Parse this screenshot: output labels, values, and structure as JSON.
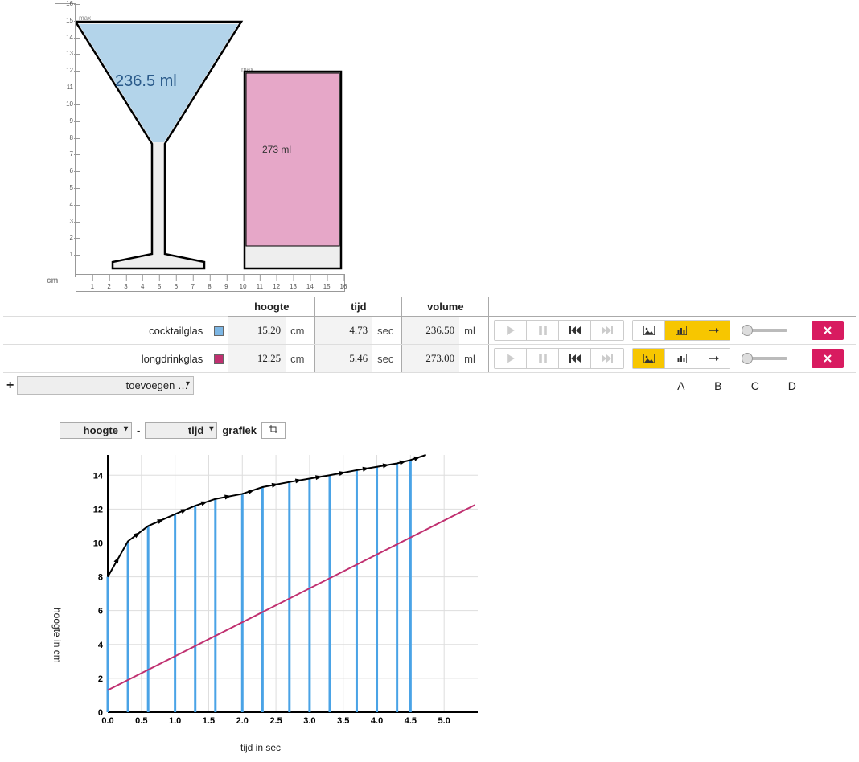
{
  "units": {
    "cm": "cm",
    "sec": "sec",
    "ml": "ml"
  },
  "max_label": "max",
  "ruler_max": 16,
  "glasses": [
    {
      "name": "cocktailglas",
      "color": "#7cb6e4",
      "swatch": "#7cb6e4",
      "hoogte": "15.20",
      "tijd": "4.73",
      "volume": "236.50",
      "display_vol": "236.5 ml",
      "active_tool": "B"
    },
    {
      "name": "longdrinkglas",
      "color": "#d070a8",
      "swatch": "#c03070",
      "hoogte": "12.25",
      "tijd": "5.46",
      "volume": "273.00",
      "display_vol": "273 ml",
      "active_tool": "A"
    }
  ],
  "headers": {
    "hoogte": "hoogte",
    "tijd": "tijd",
    "volume": "volume"
  },
  "add_label": "toevoegen …",
  "column_letters": [
    "A",
    "B",
    "C",
    "D"
  ],
  "graph_controls": {
    "y": "hoogte",
    "dash": "-",
    "x": "tijd",
    "word": "grafiek"
  },
  "axis_labels": {
    "x": "tijd in sec",
    "y": "hoogte in cm"
  },
  "chart_data": {
    "type": "line",
    "title": "",
    "xlabel": "tijd in sec",
    "ylabel": "hoogte in cm",
    "xlim": [
      0,
      5.5
    ],
    "ylim": [
      0,
      15.2
    ],
    "xticks": [
      0.0,
      0.5,
      1.0,
      1.5,
      2.0,
      2.5,
      3.0,
      3.5,
      4.0,
      4.5,
      5.0
    ],
    "yticks": [
      0,
      2,
      4,
      6,
      8,
      10,
      12,
      14
    ],
    "series": [
      {
        "name": "cocktailglas",
        "color": "#000",
        "x": [
          0.0,
          0.3,
          0.6,
          1.0,
          1.3,
          1.6,
          2.0,
          2.3,
          2.7,
          3.0,
          3.3,
          3.7,
          4.0,
          4.3,
          4.5,
          4.73
        ],
        "y": [
          8.0,
          10.1,
          11.0,
          11.7,
          12.2,
          12.6,
          12.9,
          13.3,
          13.6,
          13.8,
          14.0,
          14.3,
          14.5,
          14.7,
          14.9,
          15.2
        ]
      },
      {
        "name": "longdrinkglas",
        "color": "#c03070",
        "x": [
          0.0,
          5.46
        ],
        "y": [
          1.3,
          12.25
        ]
      }
    ],
    "bars": {
      "name": "cocktailglas-markers",
      "color": "#4aa3e6",
      "x": [
        0.0,
        0.3,
        0.6,
        1.0,
        1.3,
        1.6,
        2.0,
        2.3,
        2.7,
        3.0,
        3.3,
        3.7,
        4.0,
        4.3,
        4.5
      ],
      "y": [
        8.0,
        10.1,
        11.0,
        11.7,
        12.2,
        12.6,
        12.9,
        13.3,
        13.6,
        13.8,
        14.0,
        14.3,
        14.5,
        14.7,
        14.9
      ]
    }
  }
}
